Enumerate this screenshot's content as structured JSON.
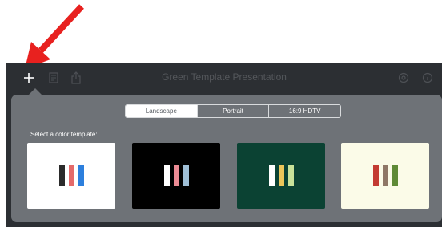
{
  "toolbar": {
    "title": "Green Template Presentation",
    "icons": [
      "plus-icon",
      "document-icon",
      "share-icon",
      "settings-icon",
      "info-icon"
    ]
  },
  "annotation": {
    "arrow_color": "#e8211f"
  },
  "popover": {
    "tabs": [
      {
        "label": "Landscape",
        "selected": true
      },
      {
        "label": "Portrait",
        "selected": false
      },
      {
        "label": "16:9 HDTV",
        "selected": false
      }
    ],
    "prompt": "Select a color template:",
    "templates": [
      {
        "name": "white",
        "background": "#ffffff",
        "colors": [
          "#2b2b2b",
          "#e46a6a",
          "#2d7fdd"
        ]
      },
      {
        "name": "black",
        "background": "#000000",
        "colors": [
          "#ffffff",
          "#eb8b94",
          "#9fbfd6"
        ]
      },
      {
        "name": "dark-green",
        "background": "#0b4233",
        "colors": [
          "#ffffff",
          "#ecc65a",
          "#c9e29a"
        ]
      },
      {
        "name": "cream",
        "background": "#fbfbe8",
        "colors": [
          "#c33b32",
          "#8f7766",
          "#5f8a36"
        ]
      }
    ]
  }
}
